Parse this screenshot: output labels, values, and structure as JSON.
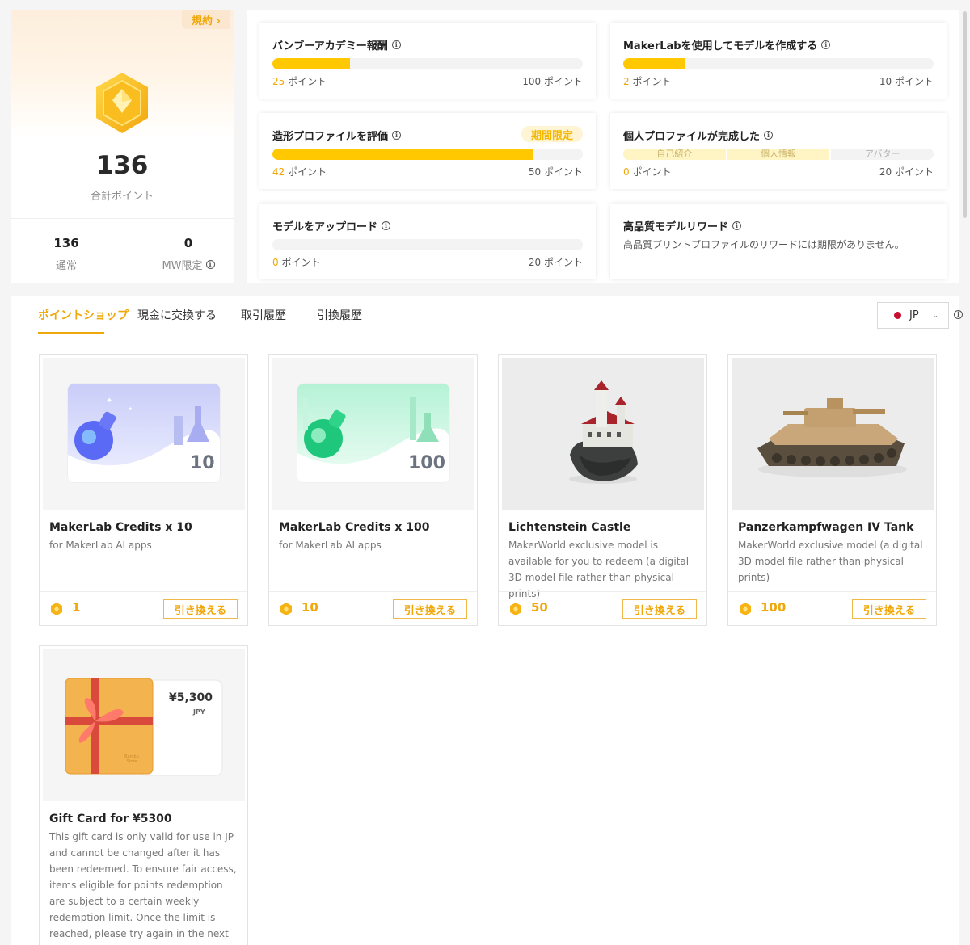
{
  "summary": {
    "rules_link": "規約 ›",
    "total_points": "136",
    "total_label": "合計ポイント",
    "normal_value": "136",
    "normal_label": "通常",
    "mw_value": "0",
    "mw_label": "MW限定"
  },
  "tasks": {
    "academy": {
      "title": "バンブーアカデミー報酬",
      "current": "25",
      "unit": " ポイント",
      "max": "100 ポイント",
      "progress": 0.25
    },
    "makerlab": {
      "title": "MakerLabを使用してモデルを作成する",
      "current": "2",
      "unit": " ポイント",
      "max": "10 ポイント",
      "progress": 0.2
    },
    "rate_profile": {
      "title": "造形プロファイルを評価",
      "badge": "期間限定",
      "current": "42",
      "unit": " ポイント",
      "max": "50 ポイント",
      "progress": 0.84
    },
    "personal_profile": {
      "title": "個人プロファイルが完成した",
      "segments": [
        "自己紹介",
        "個人情報",
        "アバター"
      ],
      "current": "0",
      "unit": " ポイント",
      "max": "20 ポイント"
    },
    "upload_model": {
      "title": "モデルをアップロード",
      "current": "0",
      "unit": " ポイント",
      "max": "20 ポイント",
      "progress": 0
    },
    "hq_reward": {
      "title": "高品質モデルリワード",
      "note": "高品質プリントプロファイルのリワードには期限がありません。"
    }
  },
  "shop": {
    "tabs": [
      "ポイントショップ",
      "現金に交換する",
      "取引履歴",
      "引換履歴"
    ],
    "region": "JP",
    "redeem_label": "引き換える",
    "products": [
      {
        "name": "MakerLab Credits x 10",
        "desc": "for MakerLab AI apps",
        "price": "1",
        "card_number": "10"
      },
      {
        "name": "MakerLab Credits x 100",
        "desc": "for MakerLab AI apps",
        "price": "10",
        "card_number": "100"
      },
      {
        "name": "Lichtenstein Castle",
        "desc": "MakerWorld exclusive model is available for you to redeem (a digital 3D model file rather than physical prints)",
        "price": "50"
      },
      {
        "name": "Panzerkampfwagen IV Tank",
        "desc": "MakerWorld exclusive model (a digital 3D model file rather than physical prints)",
        "price": "100"
      },
      {
        "name": "Gift Card for ¥5300",
        "desc": "This gift card is only valid for use in JP and cannot be changed after it has been redeemed. To ensure fair access, items eligible for points redemption are subject to a certain weekly redemption limit. Once the limit is reached, please try again in the next calendar week.",
        "card_amount": "¥5,300",
        "card_currency": "JPY",
        "card_brand": "Bambu Store"
      }
    ]
  },
  "colors": {
    "accent": "#f0a70a",
    "progress": "#ffc800"
  }
}
